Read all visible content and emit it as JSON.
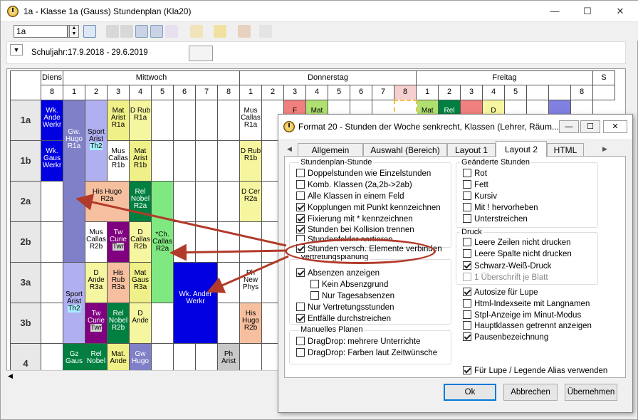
{
  "window": {
    "title": "1a - Klasse 1a (Gauss)  Stundenplan  (Kla20)",
    "minimize": "—",
    "maximize": "☐",
    "close": "✕"
  },
  "toolbar": {
    "class_value": "1a"
  },
  "schuljahr": "Schuljahr:17.9.2018 - 29.6.2019",
  "days": [
    "Diens",
    "Mittwoch",
    "Donnerstag",
    "Freitag",
    "S"
  ],
  "periods": {
    "dienstag": [
      "8"
    ],
    "mittwoch": [
      "1",
      "2",
      "3",
      "4",
      "5",
      "6",
      "7",
      "8"
    ],
    "donnerstag": [
      "1",
      "2",
      "3",
      "4",
      "5",
      "6",
      "7",
      "8"
    ],
    "freitag": [
      "1",
      "2",
      "3",
      "4",
      "5",
      "8"
    ]
  },
  "rows": [
    "1a",
    "1b",
    "2a",
    "2b",
    "3a",
    "3b",
    "4"
  ],
  "lessons": {
    "wk_ande_1a": "Wk. Ande Werkr",
    "wk_gaus_1b": "Wk. Gaus Werkr",
    "gw_hugo": "Gw. Hugo R1a",
    "sport_arist_1": "Sport Arist",
    "sport_room_1": "Th2",
    "mat_arist_r1a": "Mat Arist R1a",
    "d_rub_r1a": "D Rub R1a",
    "mus_callas_r1b": "Mus Callas R1b",
    "mat_arist_r1b": "Mat Arist R1b",
    "his_hugo_r2a": "His Hugo R2a",
    "rel_nobel_r2a": "Rel Nobel R2a",
    "ch_callas": "*Ch. Callas R2a",
    "mus_callas_r2b": "Mus Callas R2b",
    "tw_curie_1": "Tw Curie",
    "tw_room_1": "Twr",
    "d_callas_r2b": "D Callas R2b",
    "d_callas_r2b_2": "D Callas R2b",
    "sport_arist_2": "Sport Arist",
    "sport_room_2": "Th2",
    "d_ande_r3a": "D Ande R3a",
    "his_rub_r3a": "His Rub R3a",
    "mat_gaus_r3a": "Mat Gaus R3a",
    "wk_ander": "Wk. Ander Werkr",
    "tw_curie_2": "Tw Curie",
    "tw_room_2": "Twr",
    "rel_nobel_r2b": "Rel Nobel R2b",
    "d_ande": "D Ande",
    "gz_gaus": "Gz Gaus",
    "rel_nobel_4": "Rel Nobel",
    "mat_ande_4": "Mat. Ande",
    "gw_hugo_4": "Gw Hugo",
    "mus_callas_do": "Mus Callas R1a",
    "d_rub_r1b": "D Rub R1b",
    "d_cer_r2a": "D Cer R2a",
    "ph_new_phys": "Ph New Phys",
    "his_hugo_r2b": "His Hugo R2b",
    "ph_arist": "Ph Arist",
    "fr_f": "F",
    "fr_mat": "Mat",
    "fr_mat2": "Mat",
    "fr_rel": "Rel",
    "fr_d": "D"
  },
  "dialog": {
    "title": "Format 20 - Stunden der Woche senkrecht, Klassen (Lehrer, Räum...",
    "tabs": [
      "Allgemein",
      "Auswahl (Bereich)",
      "Layout 1",
      "Layout 2",
      "HTML"
    ],
    "groups": {
      "stundenplan": {
        "title": "Stundenplan-Stunde",
        "items": [
          {
            "label": "Doppelstunden wie Einzelstunden",
            "checked": false
          },
          {
            "label": "Komb. Klassen (2a,2b->2ab)",
            "checked": false
          },
          {
            "label": "Alle Klassen in einem Feld",
            "checked": false
          },
          {
            "label": "Kopplungen mit Punkt kennzeichnen",
            "checked": true
          },
          {
            "label": "Fixierung mit * kennzeichnen",
            "checked": true
          },
          {
            "label": "Stunden bei Kollision trennen",
            "checked": true
          },
          {
            "label": "Stundenfelder sortieren",
            "checked": false
          },
          {
            "label": "Stunden versch. Elemente verbinden",
            "checked": true
          }
        ]
      },
      "vertretung": {
        "title": "Vertretungsplanung",
        "items": [
          {
            "label": "Absenzen anzeigen",
            "checked": true
          },
          {
            "label": "Kein Absenzgrund",
            "checked": false
          },
          {
            "label": "Nur Tagesabsenzen",
            "checked": false
          },
          {
            "label": "Nur Vertretungsstunden",
            "checked": false
          },
          {
            "label": "Entfälle durchstreichen",
            "checked": true
          }
        ]
      },
      "manuell": {
        "title": "Manuelles Planen",
        "items": [
          {
            "label": "DragDrop: mehrere Unterrichte",
            "checked": false
          },
          {
            "label": "DragDrop: Farben laut Zeitwünsche",
            "checked": false
          }
        ]
      },
      "geaendert": {
        "title": "Geänderte Stunden",
        "items": [
          {
            "label": "Rot",
            "checked": false
          },
          {
            "label": "Fett",
            "checked": false
          },
          {
            "label": "Kursiv",
            "checked": false
          },
          {
            "label": "Mit ! hervorheben",
            "checked": false
          },
          {
            "label": "Unterstreichen",
            "checked": false
          }
        ]
      },
      "druck": {
        "title": "Druck",
        "items": [
          {
            "label": "Leere Zeilen nicht drucken",
            "checked": false
          },
          {
            "label": "Leere Spalte nicht drucken",
            "checked": false
          },
          {
            "label": "Schwarz-Weiß-Druck",
            "checked": true
          },
          {
            "label": "1 Überschrift je Blatt",
            "checked": false
          }
        ]
      },
      "misc": {
        "items": [
          {
            "label": "Autosize für Lupe",
            "checked": true
          },
          {
            "label": "Html-Indexseite mit Langnamen",
            "checked": false
          },
          {
            "label": "Stpl-Anzeige im Minut-Modus",
            "checked": false
          },
          {
            "label": "Hauptklassen getrennt anzeigen",
            "checked": false
          },
          {
            "label": "Pausenbezeichnung",
            "checked": true
          },
          {
            "label": "Für Lupe / Legende Alias verwenden",
            "checked": true
          }
        ]
      }
    },
    "buttons": {
      "ok": "Ok",
      "cancel": "Abbrechen",
      "apply": "Übernehmen"
    }
  }
}
